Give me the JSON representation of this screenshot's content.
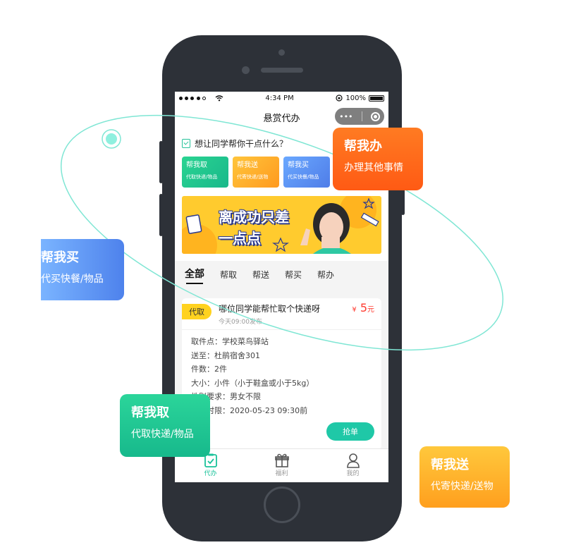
{
  "status_bar": {
    "carrier_dots": "●●●●○",
    "time": "4:34 PM",
    "battery": "100%"
  },
  "nav": {
    "title": "悬赏代办",
    "capsule_menu": "•••"
  },
  "prompt": {
    "text": "想让同学帮你干点什么？"
  },
  "services": [
    {
      "title": "帮我取",
      "sub": "代取快递/物品",
      "color": "#1fc493"
    },
    {
      "title": "帮我送",
      "sub": "代寄快递/送物",
      "color": "#ffae2a"
    },
    {
      "title": "帮我买",
      "sub": "代买快餐/物品",
      "color": "#5a8ff0"
    }
  ],
  "banner": {
    "line1": "离成功只差",
    "line2": "一点点"
  },
  "tabs": [
    "全部",
    "帮取",
    "帮送",
    "帮买",
    "帮办"
  ],
  "order": {
    "badge": "代取",
    "title": "哪位同学能帮忙取个快递呀",
    "time": "今天09:00发布",
    "price_symbol": "¥",
    "price": "5",
    "price_unit": "元",
    "details": [
      "取件点：学校菜鸟驿站",
      "送至：杜鹃宿舍301",
      "件数：2件",
      "大小：小件（小于鞋盒或小于5kg）",
      "性别要求：男女不限",
      "送达时限：2020-05-23  09:30前"
    ],
    "grab_button": "抢单"
  },
  "tabbar": [
    {
      "label": "代办",
      "icon": "task-icon",
      "active": true
    },
    {
      "label": "福利",
      "icon": "gift-icon",
      "active": false
    },
    {
      "label": "我的",
      "icon": "user-icon",
      "active": false
    }
  ],
  "callouts": {
    "ban": {
      "title": "帮我办",
      "desc": "办理其他事情"
    },
    "mai": {
      "title": "帮我买",
      "desc": "代买快餐/物品"
    },
    "qu": {
      "title": "帮我取",
      "desc": "代取快递/物品"
    },
    "song": {
      "title": "帮我送",
      "desc": "代寄快递/送物"
    }
  },
  "colors": {
    "accent": "#1fc8a7",
    "price": "#ff3b30",
    "orbit": "#7fe6d4"
  }
}
